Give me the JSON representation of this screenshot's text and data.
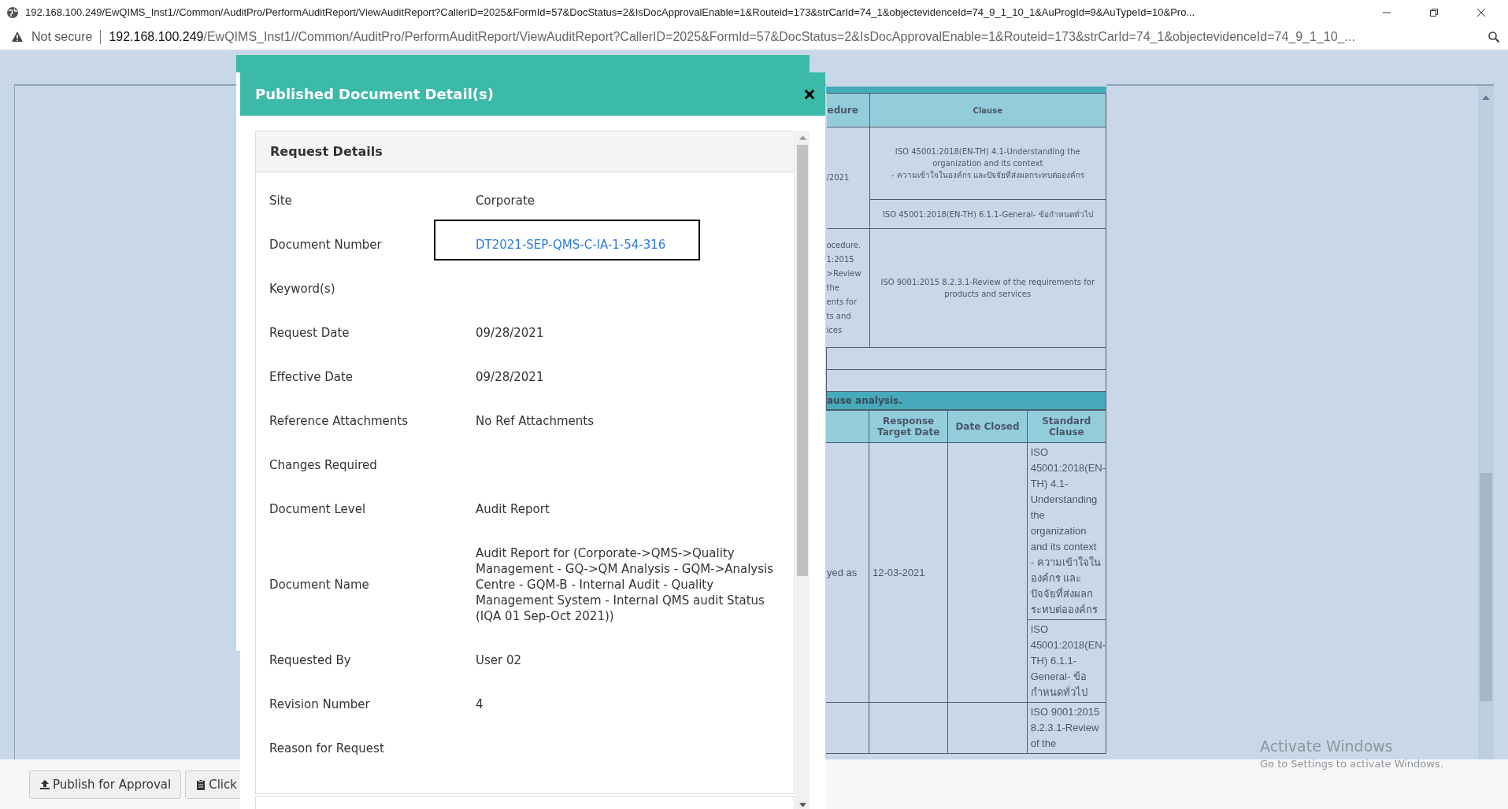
{
  "browser": {
    "title": "192.168.100.249/EwQIMS_Inst1//Common/AuditPro/PerformAuditReport/ViewAuditReport?CallerID=2025&FormId=57&DocStatus=2&IsDocApprovalEnable=1&Routeid=173&strCarId=74_1&objectevidenceId=74_9_1_10_1&AuProgId=9&AuTypeId=10&Pro...",
    "security": "Not secure",
    "url_host": "192.168.100.249",
    "url_path": "/EwQIMS_Inst1//Common/AuditPro/PerformAuditReport/ViewAuditReport?CallerID=2025&FormId=57&DocStatus=2&IsDocApprovalEnable=1&Routeid=173&strCarId=74_1&objectevidenceId=74_9_1_10_..."
  },
  "clause_table": {
    "columns": [
      "edure",
      "Clause"
    ],
    "rows": [
      {
        "column_1": "/2021",
        "clauses": [
          "ISO 45001:2018(EN-TH) 4.1-Understanding the organization and its context\n- ความเข้าใจในองค์กร และปัจจัยที่ส่งผลกระทบต่อองค์กร",
          "ISO 45001:2018(EN-TH) 6.1.1-General- ข้อกำหนดทั่วไป"
        ]
      },
      {
        "column_1": "ocedure.\n1:2015\n>Review\nthe\nents for\nts and\nices",
        "clauses": [
          "ISO 9001:2015 8.2.3.1-Review of the requirements for products and services"
        ]
      }
    ]
  },
  "analysis_section": {
    "title": "ause analysis.",
    "columns": [
      "Response Target Date",
      "Date Closed",
      "Standard Clause"
    ],
    "rows": [
      {
        "column_1": "yed as",
        "response_target_date": "12-03-2021",
        "standard_clauses": [
          "ISO 45001:2018(EN-TH) 4.1-Understanding the organization and its context - ความเข้าใจในองค์กร และปัจจัยที่ส่งผลกระทบต่อองค์กร",
          "ISO 45001:2018(EN-TH) 6.1.1-General- ข้อกำหนดทั่วไป"
        ]
      },
      {
        "standard_clauses": [
          "ISO 9001:2015 8.2.3.1-Review of the"
        ]
      }
    ]
  },
  "footer_buttons": [
    {
      "label": "Publish for Approval",
      "kind": "upload"
    },
    {
      "label": "Click",
      "kind": "clipboard"
    }
  ],
  "os_notice": {
    "title": "Activate Windows",
    "subtitle": "Go to Settings to activate Windows."
  },
  "dialog": {
    "title": "Published Document Detail(s)",
    "panel_title": "Request Details",
    "fields": [
      {
        "label": "Site",
        "value": "Corporate",
        "kind": "text",
        "highlighted": false
      },
      {
        "label": "Document Number",
        "value": "DT2021-SEP-QMS-C-IA-1-54-316",
        "kind": "link",
        "highlighted": true
      },
      {
        "label": "Keyword(s)",
        "highlighted": false
      },
      {
        "label": "Request Date",
        "value": "09/28/2021",
        "kind": "text",
        "highlighted": false
      },
      {
        "label": "Effective Date",
        "value": "09/28/2021",
        "kind": "text",
        "highlighted": false
      },
      {
        "label": "Reference Attachments",
        "value": "No Ref Attachments",
        "kind": "text",
        "highlighted": false
      },
      {
        "label": "Changes Required",
        "highlighted": false
      },
      {
        "label": "Document Level",
        "value": "Audit Report",
        "kind": "text",
        "highlighted": false
      },
      {
        "label": "Document Name",
        "value": "Audit Report for (Corporate->QMS->Quality Management - GQ->QM Analysis - GQM->Analysis Centre - GQM-B - Internal Audit - Quality Management System - Internal QMS audit Status (IQA 01 Sep-Oct 2021))",
        "kind": "text",
        "highlighted": false
      },
      {
        "label": "Requested By",
        "value": "User 02",
        "kind": "text",
        "highlighted": false
      },
      {
        "label": "Revision Number",
        "value": "4",
        "kind": "text",
        "highlighted": false
      },
      {
        "label": "Reason for Request",
        "highlighted": false
      }
    ]
  }
}
